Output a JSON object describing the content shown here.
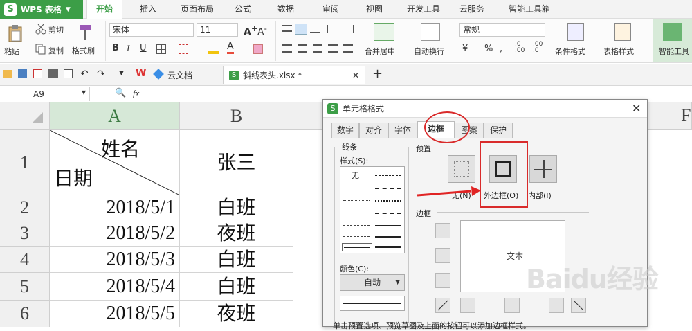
{
  "titlebar": {
    "app_name": "WPS 表格",
    "menus": [
      "开始",
      "插入",
      "页面布局",
      "公式",
      "数据",
      "审阅",
      "视图",
      "开发工具",
      "云服务",
      "智能工具箱"
    ]
  },
  "ribbon": {
    "paste": "粘贴",
    "cut": "剪切",
    "copy": "复制",
    "format_painter": "格式刷",
    "font_name": "宋体",
    "font_size": "11",
    "merge_center": "合并居中",
    "wrap_text": "自动换行",
    "number_format": "常规",
    "conditional_format": "条件格式",
    "table_style": "表格样式",
    "smart_tools": "智能工具"
  },
  "qat": {
    "cloud_doc": "云文档",
    "file_tab": "斜线表头.xlsx *"
  },
  "formula_bar": {
    "cell_ref": "A9",
    "fx": "fx"
  },
  "sheet": {
    "columns": [
      "A",
      "B",
      "F"
    ],
    "rows": [
      {
        "num": "1",
        "a_top": "姓名",
        "a_bottom": "日期",
        "b": "张三"
      },
      {
        "num": "2",
        "a": "2018/5/1",
        "b": "白班"
      },
      {
        "num": "3",
        "a": "2018/5/2",
        "b": "夜班"
      },
      {
        "num": "4",
        "a": "2018/5/3",
        "b": "白班"
      },
      {
        "num": "5",
        "a": "2018/5/4",
        "b": "白班"
      },
      {
        "num": "6",
        "a": "2018/5/5",
        "b": "夜班"
      }
    ]
  },
  "dialog": {
    "title": "单元格格式",
    "tabs": [
      "数字",
      "对齐",
      "字体",
      "边框",
      "图案",
      "保护"
    ],
    "active_tab": "边框",
    "line_group": "线条",
    "style_label": "样式(S):",
    "style_none": "无",
    "color_label": "颜色(C):",
    "color_value": "自动",
    "presets_label": "预置",
    "preset_none": "无(N)",
    "preset_outline": "外边框(O)",
    "preset_inside": "内部(I)",
    "border_label": "边框",
    "preview_text": "文本",
    "hint": "单击预置选项、预览草图及上面的按钮可以添加边框样式。"
  },
  "watermark": "Baidu经验",
  "colors": {
    "accent": "#3c9e47",
    "annotation": "#e02424"
  }
}
